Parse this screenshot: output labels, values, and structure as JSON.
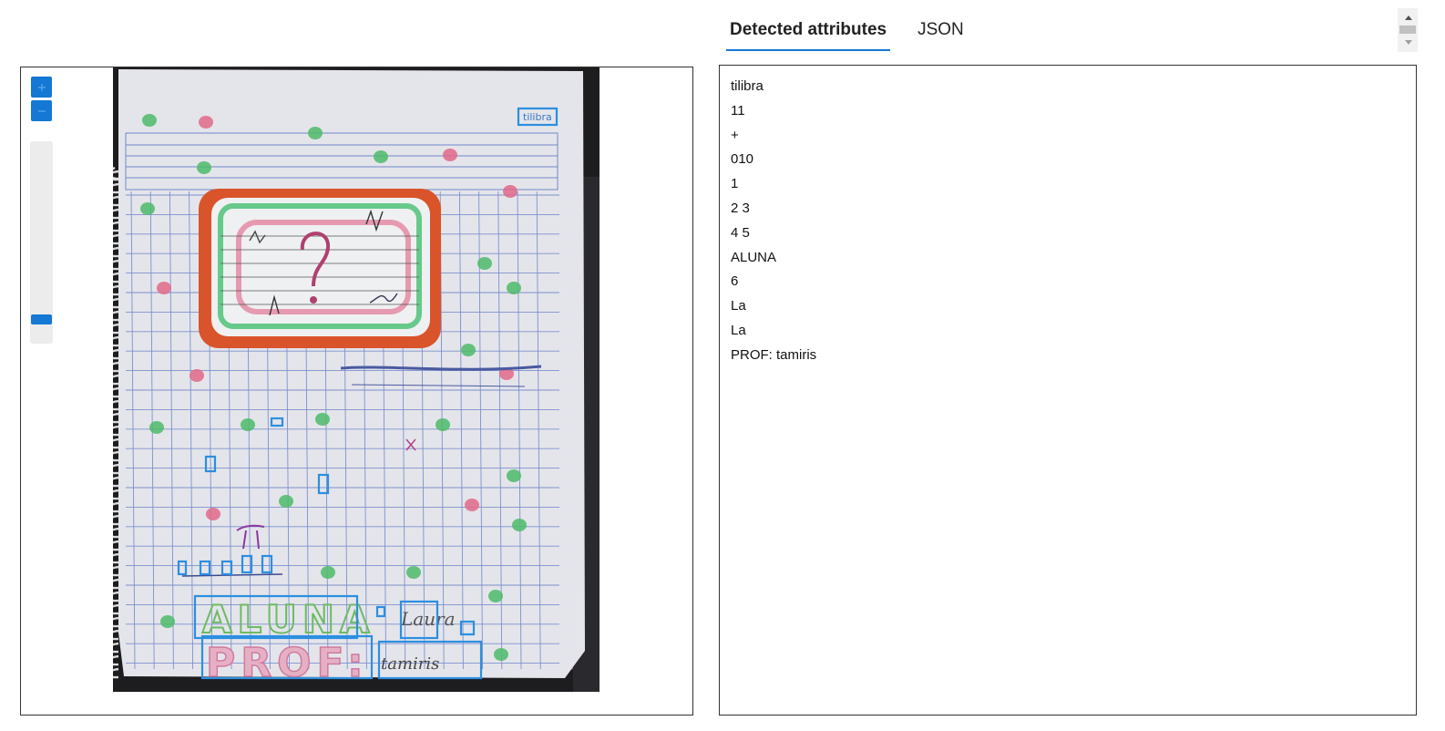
{
  "tabs": [
    {
      "label": "Detected attributes",
      "active": true
    },
    {
      "label": "JSON",
      "active": false
    }
  ],
  "viewer": {
    "controls": {
      "zoom_in_icon": "plus-icon",
      "zoom_out_icon": "minus-icon",
      "zoom_level_fraction": 0.05
    },
    "image_description_marks": {
      "header_logo_text": "tilibra",
      "big_title_text": "ALUNA",
      "prof_text": "PROF:",
      "teacher_text": "tamiris",
      "name_text": "Laura"
    }
  },
  "detected_attributes": [
    "tilibra",
    "11",
    "+",
    "010",
    "1",
    "2 3",
    "4 5",
    "ALUNA",
    "6",
    "La",
    "La",
    "PROF: tamiris"
  ],
  "colors": {
    "accent": "#1478d4",
    "bbox": "#2b8fe0",
    "frame_orange": "#d9542a",
    "green_dot": "#4dbb6a",
    "pink_dot": "#e06a8a"
  }
}
